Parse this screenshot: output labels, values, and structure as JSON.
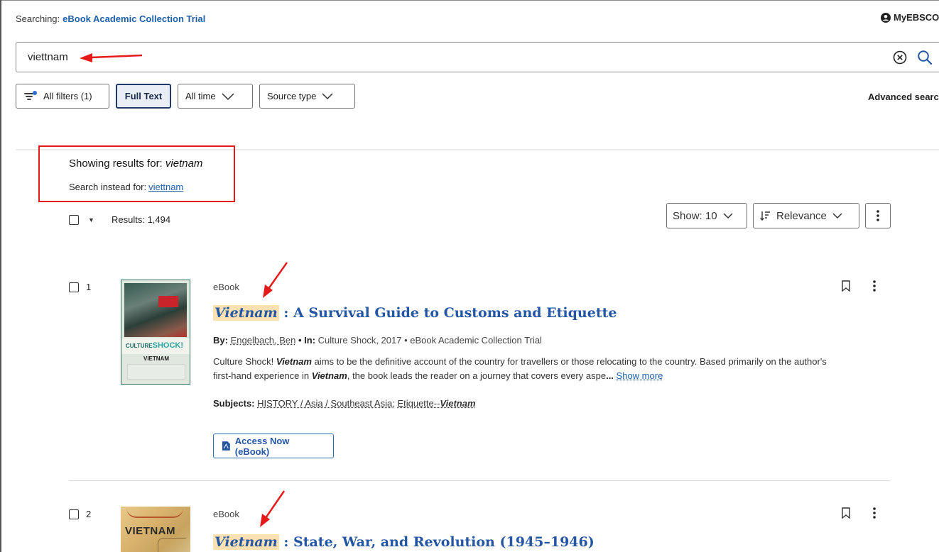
{
  "header": {
    "searching_label": "Searching:",
    "collection": "eBook Academic Collection Trial",
    "account": "MyEBSCO"
  },
  "search": {
    "query": "viettnam"
  },
  "filters": {
    "all_filters": "All filters (1)",
    "full_text": "Full Text",
    "all_time": "All time",
    "source_type": "Source type",
    "advanced": "Advanced search"
  },
  "correction": {
    "showing_prefix": "Showing results for:",
    "showing_term": "vietnam",
    "instead_prefix": "Search instead for:",
    "instead_term": "viettnam"
  },
  "toolbar": {
    "results": "Results: 1,494",
    "show": "Show: 10",
    "sort": "Relevance"
  },
  "results": [
    {
      "num": "1",
      "type": "eBook",
      "title_hl": "Vietnam",
      "title_rest": ": A Survival Guide to Customs and Etiquette",
      "by_label": "By:",
      "author": "Engelbach, Ben",
      "in_label": "• In:",
      "in_value": "Culture Shock, 2017 • eBook Academic Collection Trial",
      "abs_1": "Culture Shock! ",
      "abs_2": "Vietnam",
      "abs_3": " aims to be the definitive account of the country for travellers or those relocating to the country. Based primarily on the author's first-hand experience in ",
      "abs_4": "Vietnam",
      "abs_5": ", the book leads the reader on a journey that covers every aspe",
      "abs_ellipsis": "...",
      "show_more": "Show more",
      "subjects_label": "Subjects:",
      "subject_1": "HISTORY / Asia / Southeast Asia;",
      "subject_2a": "Etiquette--",
      "subject_2b": "Vietnam",
      "access": "Access Now (eBook)",
      "cover_brand": "CULTURE",
      "cover_brand_accent": "SHOCK!",
      "cover_country": "VIETNAM"
    },
    {
      "num": "2",
      "type": "eBook",
      "title_hl": "Vietnam",
      "title_rest": ": State, War, and Revolution (1945–1946)",
      "cover_country": "VIETNAM"
    }
  ]
}
